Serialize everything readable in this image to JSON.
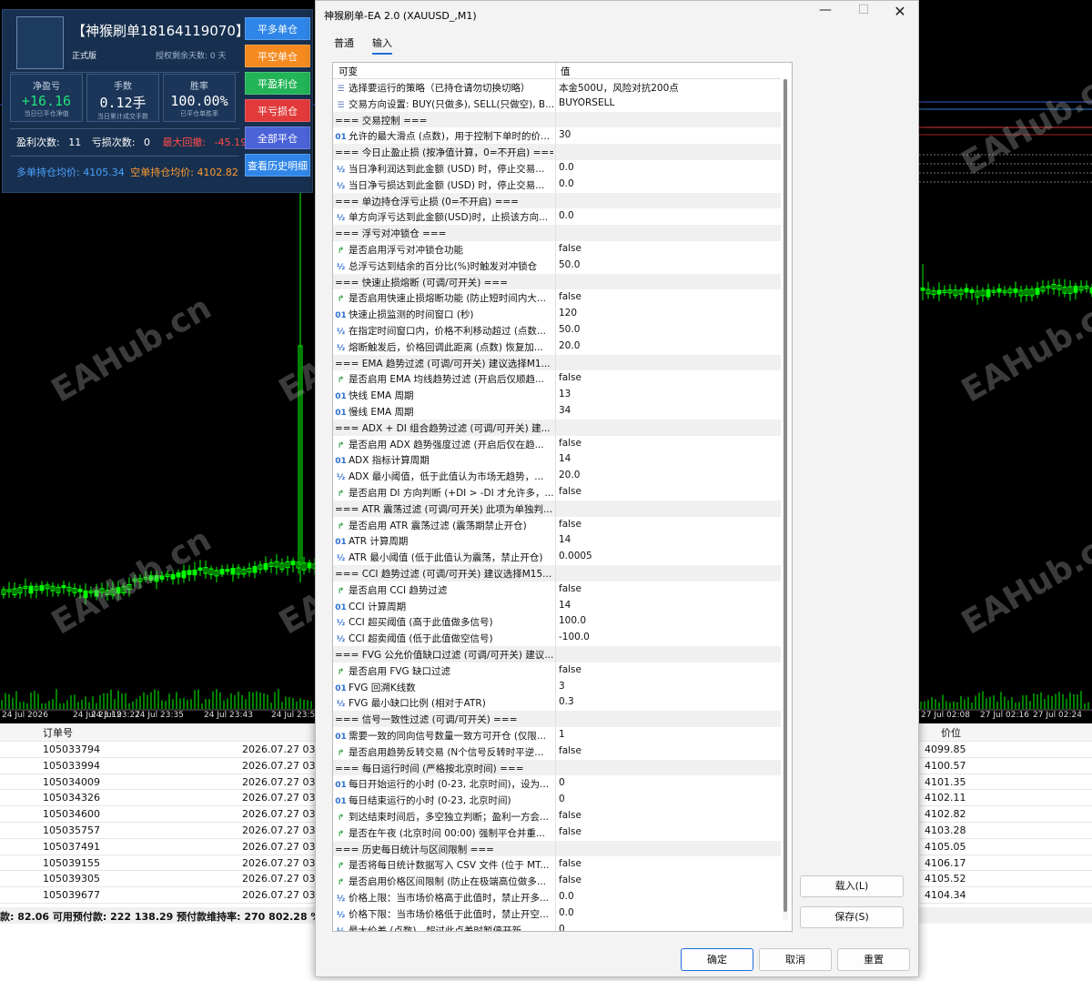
{
  "chart": {
    "time_labels": [
      "24 Jul 2026",
      "24 Jul 23:19",
      "24 Jul 23:27",
      "24 Jul 23:35",
      "24 Jul 23:43",
      "24 Jul 23:51",
      "27 Jul 02:08",
      "27 Jul 02:16",
      "27 Jul 02:24"
    ],
    "watermark": "EAHub.cn",
    "colors": {
      "candle": "#00ff00",
      "background": "#000000"
    }
  },
  "ea_panel": {
    "name": "【神猴刷单18164119070】",
    "version": "正式版",
    "license": "授权剩余天数: 0 天",
    "stats": [
      {
        "title": "净盈亏",
        "value": "+16.16",
        "sub": "当日已平仓净值",
        "color": "#22e07a"
      },
      {
        "title": "手数",
        "value": "0.12手",
        "sub": "当日累计成交手数",
        "color": "#ffffff"
      },
      {
        "title": "胜率",
        "value": "100.00%",
        "sub": "已平仓单胜率",
        "color": "#ffffff"
      }
    ],
    "profit_count_label": "盈利次数:",
    "profit_count": "11",
    "loss_count_label": "亏损次数:",
    "loss_count": "0",
    "max_drawdown_label": "最大回撤:",
    "max_drawdown": "-45.19",
    "long_avg_label": "多单持仓均价:",
    "long_avg": "4105.34",
    "short_avg_label": "空单持仓均价:",
    "short_avg": "4102.82",
    "buttons": [
      {
        "label": "平多单仓",
        "color": "#2f86e8"
      },
      {
        "label": "平空单仓",
        "color": "#f58a1f"
      },
      {
        "label": "平盈利仓",
        "color": "#22b457"
      },
      {
        "label": "平亏损仓",
        "color": "#e23a3a"
      },
      {
        "label": "全部平仓",
        "color": "#4c63d8"
      },
      {
        "label": "查看历史明细",
        "color": "#2f86e8"
      }
    ]
  },
  "terminal": {
    "headers": {
      "order": "订单号",
      "price": "价位"
    },
    "rows": [
      {
        "order": "105033794",
        "time": "2026.07.27 03:4",
        "price": "4099.85"
      },
      {
        "order": "105033994",
        "time": "2026.07.27 03:4",
        "price": "4100.57"
      },
      {
        "order": "105034009",
        "time": "2026.07.27 03:4",
        "price": "4101.35"
      },
      {
        "order": "105034326",
        "time": "2026.07.27 03:4",
        "price": "4102.11"
      },
      {
        "order": "105034600",
        "time": "2026.07.27 03:4",
        "price": "4102.82"
      },
      {
        "order": "105035757",
        "time": "2026.07.27 03:4",
        "price": "4103.28"
      },
      {
        "order": "105037491",
        "time": "2026.07.27 03:4",
        "price": "4105.05"
      },
      {
        "order": "105039155",
        "time": "2026.07.27 03:4",
        "price": "4106.17"
      },
      {
        "order": "105039305",
        "time": "2026.07.27 03:4",
        "price": "4105.52"
      },
      {
        "order": "105039677",
        "time": "2026.07.27 03:4",
        "price": "4104.34"
      }
    ],
    "status": "款: 82.06  可用预付款: 222 138.29  预付款维持率: 270 802.28 %"
  },
  "dialog": {
    "title": "神猴刷单-EA 2.0 (XAUUSD_,M1)",
    "tabs": [
      "普通",
      "输入"
    ],
    "active_tab": 1,
    "col_var": "可变",
    "col_val": "值",
    "params": [
      {
        "icon": "enum",
        "name": "选择要运行的策略（已持仓请勿切换切略）",
        "value": "本金500U，风险对抗200点"
      },
      {
        "icon": "enum",
        "name": "交易方向设置: BUY(只做多), SELL(只做空), B...",
        "value": "BUYORSELL"
      },
      {
        "icon": "sep",
        "name": "=== 交易控制 ===",
        "value": ""
      },
      {
        "icon": "int",
        "name": "允许的最大滑点 (点数)，用于控制下单时的价...",
        "value": "30"
      },
      {
        "icon": "sep",
        "name": "=== 今日止盈止损 (按净值计算，0=不开启) ===",
        "value": ""
      },
      {
        "icon": "dbl",
        "name": "当日净利润达到此金额 (USD) 时，停止交易...",
        "value": "0.0"
      },
      {
        "icon": "dbl",
        "name": "当日净亏损达到此金额 (USD) 时，停止交易...",
        "value": "0.0"
      },
      {
        "icon": "sep",
        "name": "=== 单边持仓浮亏止损 (0=不开启) ===",
        "value": ""
      },
      {
        "icon": "dbl",
        "name": "单方向浮亏达到此金额(USD)时，止损该方向...",
        "value": "0.0"
      },
      {
        "icon": "sep",
        "name": "=== 浮亏对冲锁仓 ===",
        "value": ""
      },
      {
        "icon": "bool",
        "name": "是否启用浮亏对冲锁仓功能",
        "value": "false"
      },
      {
        "icon": "dbl",
        "name": "总浮亏达到结余的百分比(%)时触发对冲锁仓",
        "value": "50.0"
      },
      {
        "icon": "sep",
        "name": "=== 快速止损熔断 (可调/可开关) ===",
        "value": ""
      },
      {
        "icon": "bool",
        "name": "是否启用快速止损熔断功能 (防止短时间内大...",
        "value": "false"
      },
      {
        "icon": "int",
        "name": "快速止损监测的时间窗口 (秒)",
        "value": "120"
      },
      {
        "icon": "dbl",
        "name": "在指定时间窗口内，价格不利移动超过 (点数...",
        "value": "50.0"
      },
      {
        "icon": "dbl",
        "name": "熔断触发后，价格回调此距离 (点数) 恢复加...",
        "value": "20.0"
      },
      {
        "icon": "sep",
        "name": "=== EMA 趋势过滤 (可调/可开关) 建议选择M1...",
        "value": ""
      },
      {
        "icon": "bool",
        "name": "是否启用 EMA 均线趋势过滤 (开启后仅顺趋...",
        "value": "false"
      },
      {
        "icon": "int",
        "name": "快线 EMA 周期",
        "value": "13"
      },
      {
        "icon": "int",
        "name": "慢线 EMA 周期",
        "value": "34"
      },
      {
        "icon": "sep",
        "name": "=== ADX + DI 组合趋势过滤 (可调/可开关) 建...",
        "value": ""
      },
      {
        "icon": "bool",
        "name": "是否启用 ADX 趋势强度过滤 (开启后仅在趋...",
        "value": "false"
      },
      {
        "icon": "int",
        "name": "ADX 指标计算周期",
        "value": "14"
      },
      {
        "icon": "dbl",
        "name": "ADX 最小阈值，低于此值认为市场无趋势，...",
        "value": "20.0"
      },
      {
        "icon": "bool",
        "name": "是否启用 DI 方向判断 (+DI > -DI 才允许多，...",
        "value": "false"
      },
      {
        "icon": "sep",
        "name": "=== ATR 震荡过滤 (可调/可开关) 此项为单独判...",
        "value": ""
      },
      {
        "icon": "bool",
        "name": "是否启用 ATR 震荡过滤 (震荡期禁止开仓)",
        "value": "false"
      },
      {
        "icon": "int",
        "name": "ATR 计算周期",
        "value": "14"
      },
      {
        "icon": "dbl",
        "name": "ATR 最小阈值 (低于此值认为震荡，禁止开仓)",
        "value": "0.0005"
      },
      {
        "icon": "sep",
        "name": "=== CCI 趋势过滤 (可调/可开关) 建议选择M15...",
        "value": ""
      },
      {
        "icon": "bool",
        "name": "是否启用 CCI 趋势过滤",
        "value": "false"
      },
      {
        "icon": "int",
        "name": "CCI 计算周期",
        "value": "14"
      },
      {
        "icon": "dbl",
        "name": "CCI 超买阈值 (高于此值做多信号)",
        "value": "100.0"
      },
      {
        "icon": "dbl",
        "name": "CCI 超卖阈值 (低于此值做空信号)",
        "value": "-100.0"
      },
      {
        "icon": "sep",
        "name": "=== FVG 公允价值缺口过滤 (可调/可开关) 建议...",
        "value": ""
      },
      {
        "icon": "bool",
        "name": "是否启用 FVG 缺口过滤",
        "value": "false"
      },
      {
        "icon": "int",
        "name": "FVG 回溯K线数",
        "value": "3"
      },
      {
        "icon": "dbl",
        "name": "FVG 最小缺口比例 (相对于ATR)",
        "value": "0.3"
      },
      {
        "icon": "sep",
        "name": "=== 信号一致性过滤 (可调/可开关) ===",
        "value": ""
      },
      {
        "icon": "int",
        "name": "需要一致的同向信号数量一致方可开仓 (仅限...",
        "value": "1"
      },
      {
        "icon": "bool",
        "name": "是否启用趋势反转交易 (N个信号反转时平逆...",
        "value": "false"
      },
      {
        "icon": "sep",
        "name": "=== 每日运行时间 (严格按北京时间) ===",
        "value": ""
      },
      {
        "icon": "int",
        "name": "每日开始运行的小时 (0-23, 北京时间)，设为...",
        "value": "0"
      },
      {
        "icon": "int",
        "name": "每日结束运行的小时 (0-23, 北京时间)",
        "value": "0"
      },
      {
        "icon": "bool",
        "name": "到达结束时间后，多空独立判断；盈利一方会...",
        "value": "false"
      },
      {
        "icon": "bool",
        "name": "是否在午夜 (北京时间 00:00) 强制平仓并重...",
        "value": "false"
      },
      {
        "icon": "sep",
        "name": "=== 历史每日统计与区间限制 ===",
        "value": ""
      },
      {
        "icon": "bool",
        "name": "是否将每日统计数据写入 CSV 文件 (位于 MT...",
        "value": "false"
      },
      {
        "icon": "bool",
        "name": "是否启用价格区间限制 (防止在极端高位做多...",
        "value": "false"
      },
      {
        "icon": "dbl",
        "name": "价格上限：当市场价格高于此值时，禁止开多...",
        "value": "0.0"
      },
      {
        "icon": "dbl",
        "name": "价格下限：当市场价格低于此值时，禁止开空...",
        "value": "0.0"
      },
      {
        "icon": "dbl",
        "name": "最大价差 (点数)，超过此点差时暂停开新...",
        "value": "0"
      }
    ],
    "load_label": "载入(L)",
    "save_label": "保存(S)",
    "ok_label": "确定",
    "cancel_label": "取消",
    "reset_label": "重置"
  }
}
